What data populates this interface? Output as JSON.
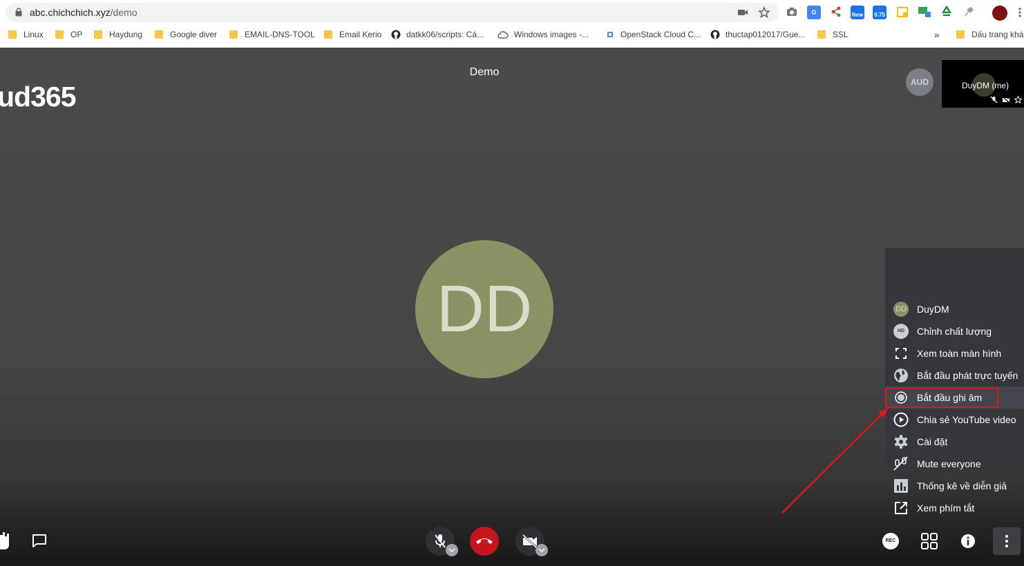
{
  "browser": {
    "url_host": "abc.chichchich.xyz",
    "url_path": "/demo",
    "extension_badges": {
      "new": "New",
      "speed": "0.75"
    },
    "bookmarks": [
      {
        "label": "Linux",
        "icon": "folder-icon"
      },
      {
        "label": "OP",
        "icon": "folder-icon"
      },
      {
        "label": "Haydung",
        "icon": "folder-icon"
      },
      {
        "label": "Google diver",
        "icon": "folder-icon"
      },
      {
        "label": "EMAIL-DNS-TOOL",
        "icon": "folder-icon"
      },
      {
        "label": "Email Kerio",
        "icon": "folder-icon"
      },
      {
        "label": "datkk06/scripts: Cá...",
        "icon": "github-icon"
      },
      {
        "label": "Windows images -...",
        "icon": "cloud-icon"
      },
      {
        "label": "OpenStack Cloud C...",
        "icon": "openstack-icon"
      },
      {
        "label": "thuctap012017/Gue...",
        "icon": "github-icon"
      },
      {
        "label": "SSL",
        "icon": "folder-icon"
      },
      {
        "label": "Dấu trang khá",
        "icon": "folder-icon"
      }
    ],
    "overflow_label": "»"
  },
  "meeting": {
    "title": "Demo",
    "logo_text": "ud365",
    "main_avatar_initials": "DD",
    "remote_avatar_initials": "AUD",
    "self_tile_name": "DuyDM (me)"
  },
  "menu": {
    "avatar_initials": "DD",
    "hd_badge": "HD",
    "items": [
      {
        "label": "DuyDM",
        "icon": "avatar-icon"
      },
      {
        "label": "Chỉnh chất lượng",
        "icon": "hd-icon"
      },
      {
        "label": "Xem toàn màn hình",
        "icon": "fullscreen-icon"
      },
      {
        "label": "Bắt đầu phát trực tuyến",
        "icon": "globe-icon"
      },
      {
        "label": "Bắt đầu ghi âm",
        "icon": "record-icon"
      },
      {
        "label": "Chia sẻ YouTube video",
        "icon": "play-icon"
      },
      {
        "label": "Cài đặt",
        "icon": "gear-icon"
      },
      {
        "label": "Mute everyone",
        "icon": "mute-all-icon"
      },
      {
        "label": "Thống kê về diễn giả",
        "icon": "stats-icon"
      },
      {
        "label": "Xem phím tắt",
        "icon": "external-link-icon"
      }
    ],
    "highlighted_index": 4
  },
  "toolbar": {
    "rec_label": "REC",
    "hangup_color": "#c4161c",
    "accent_red": "#e0161b"
  }
}
